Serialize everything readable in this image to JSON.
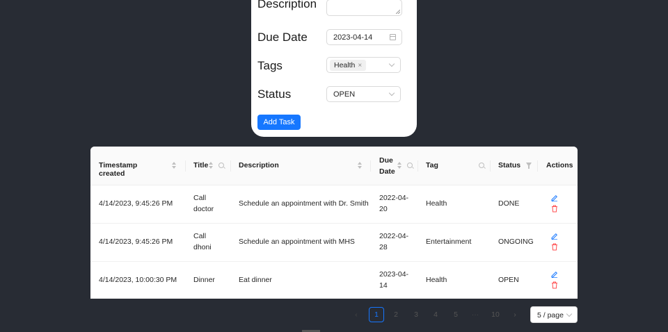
{
  "form": {
    "description_label": "Description",
    "due_date_label": "Due Date",
    "due_date_value": "2023-04-14",
    "tags_label": "Tags",
    "tags_selected": "Health",
    "tag_remove_glyph": "×",
    "status_label": "Status",
    "status_value": "OPEN",
    "add_button": "Add Task"
  },
  "table": {
    "columns": [
      "Timestamp created",
      "Title",
      "Description",
      "Due Date",
      "Tag",
      "Status",
      "Actions"
    ],
    "rows": [
      {
        "timestamp": "4/14/2023, 9:45:26 PM",
        "title": [
          "Call",
          "doctor"
        ],
        "description": "Schedule an appointment with Dr. Smith",
        "due": [
          "2022-04-",
          "20"
        ],
        "tag": "Health",
        "status": "DONE"
      },
      {
        "timestamp": "4/14/2023, 9:45:26 PM",
        "title": [
          "Call",
          "dhoni"
        ],
        "description": "Schedule an appointment with MHS",
        "due": [
          "2022-04-",
          "28"
        ],
        "tag": "Entertainment",
        "status": "ONGOING"
      },
      {
        "timestamp": "4/14/2023, 10:00:30 PM",
        "title": [
          "Dinner",
          ""
        ],
        "description": "Eat dinner",
        "due": [
          "2023-04-",
          "14"
        ],
        "tag": "Health",
        "status": "OPEN"
      }
    ]
  },
  "pagination": {
    "prev": "‹",
    "pages": [
      "1",
      "2",
      "3",
      "4",
      "5"
    ],
    "ellipsis": "···",
    "last": "10",
    "next": "›",
    "current": "1",
    "page_size": "5 / page"
  },
  "colors": {
    "background": "#282c34",
    "primary": "#1677ff",
    "danger": "#ff4d4f"
  },
  "icons": {
    "edit": "edit-icon",
    "delete": "delete-icon",
    "calendar": "calendar-icon",
    "search": "search-icon",
    "filter": "filter-icon",
    "sort": "sort-icon"
  }
}
